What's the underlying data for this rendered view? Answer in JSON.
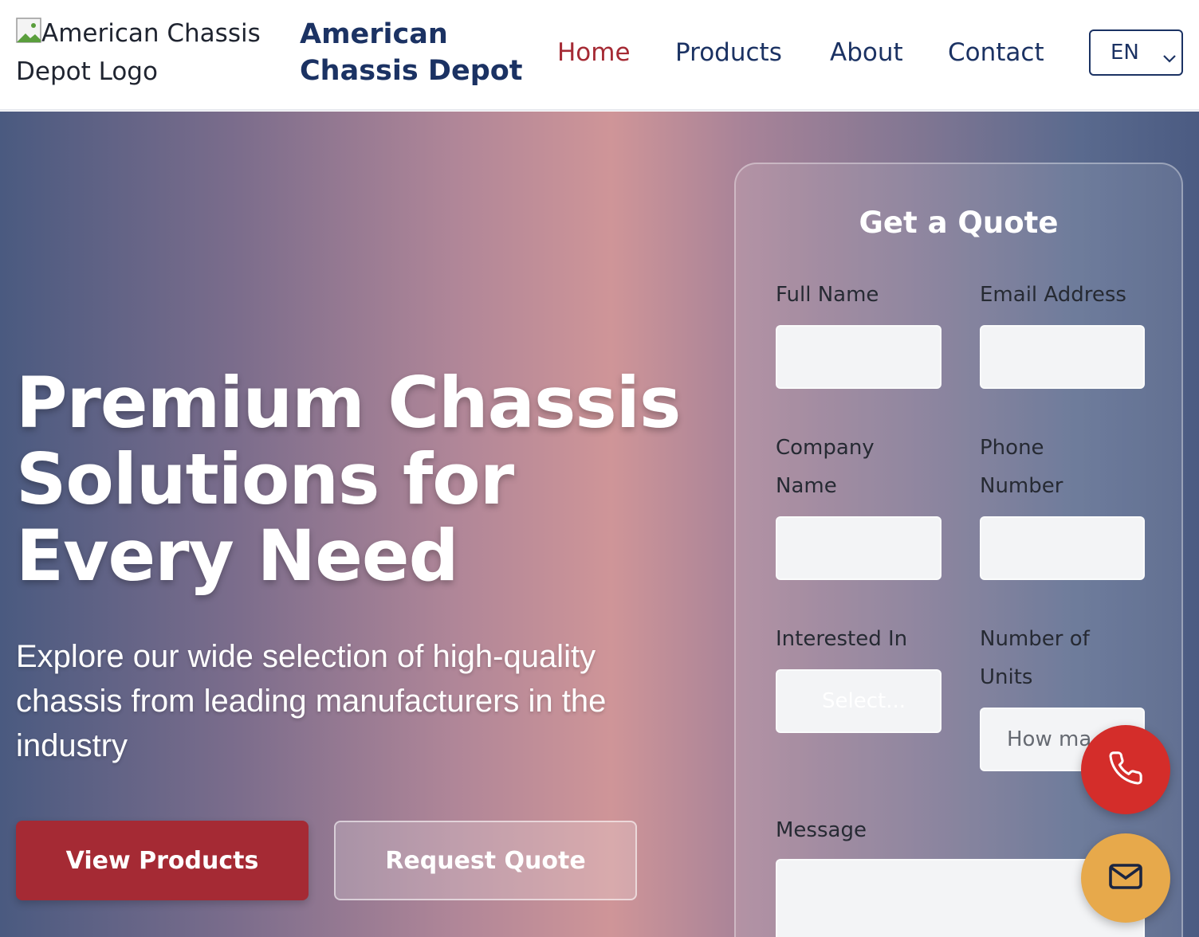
{
  "header": {
    "logo_alt": "American Chassis Depot Logo",
    "brand_line1": "American",
    "brand_line2": "Chassis Depot",
    "nav": [
      {
        "label": "Home",
        "active": true
      },
      {
        "label": "Products",
        "active": false
      },
      {
        "label": "About",
        "active": false
      },
      {
        "label": "Contact",
        "active": false
      }
    ],
    "language": "EN"
  },
  "hero": {
    "title_line1": "Premium Chassis",
    "title_line2": "Solutions for",
    "title_line3": "Every Need",
    "subtitle": "Explore our wide selection of high-quality chassis from leading manufacturers in the industry",
    "primary_button": "View Products",
    "secondary_button": "Request Quote"
  },
  "quote_form": {
    "title": "Get a Quote",
    "full_name_label": "Full Name",
    "email_label": "Email Address",
    "company_label_line1": "Company",
    "company_label_line2": "Name",
    "phone_label_line1": "Phone",
    "phone_label_line2": "Number",
    "interested_label": "Interested In",
    "interested_value": "Select...",
    "units_label_line1": "Number of",
    "units_label_line2": "Units",
    "units_placeholder": "How ma",
    "message_label": "Message"
  },
  "floating": {
    "phone_icon": "phone-icon",
    "mail_icon": "mail-icon"
  },
  "colors": {
    "brand_navy": "#1b3263",
    "accent_red": "#a52a34",
    "phone_fab": "#d42d2a",
    "mail_fab": "#e7a94b"
  }
}
